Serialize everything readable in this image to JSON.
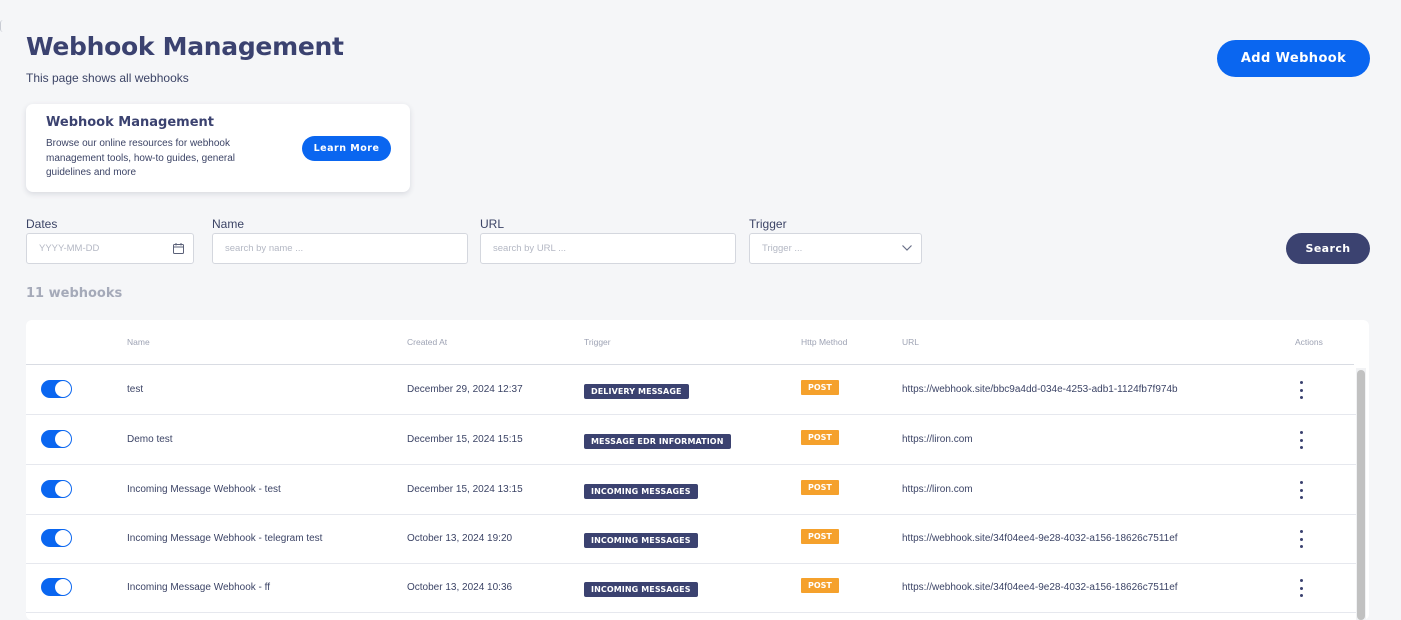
{
  "header": {
    "title": "Webhook Management",
    "subtitle": "This page shows all webhooks",
    "add_button": "Add Webhook"
  },
  "info_card": {
    "title": "Webhook Management",
    "description": "Browse our online resources for webhook management tools, how-to guides, general guidelines and more",
    "button": "Learn More"
  },
  "filters": {
    "dates": {
      "label": "Dates",
      "placeholder": "YYYY-MM-DD"
    },
    "name": {
      "label": "Name",
      "placeholder": "search by name ..."
    },
    "url": {
      "label": "URL",
      "placeholder": "search by URL ..."
    },
    "trigger": {
      "label": "Trigger",
      "placeholder": "Trigger ..."
    },
    "search_button": "Search"
  },
  "count_label": "11 webhooks",
  "table": {
    "columns": [
      "Name",
      "Created At",
      "Trigger",
      "Http Method",
      "URL",
      "Actions"
    ],
    "rows": [
      {
        "enabled": true,
        "name": "test",
        "created_at": "December 29, 2024 12:37",
        "trigger": "DELIVERY MESSAGE",
        "method": "POST",
        "url": "https://webhook.site/bbc9a4dd-034e-4253-adb1-1124fb7f974b"
      },
      {
        "enabled": true,
        "name": "Demo test",
        "created_at": "December 15, 2024 15:15",
        "trigger": "MESSAGE EDR INFORMATION",
        "method": "POST",
        "url": "https://liron.com"
      },
      {
        "enabled": true,
        "name": "Incoming Message Webhook - test",
        "created_at": "December 15, 2024 13:15",
        "trigger": "INCOMING MESSAGES",
        "method": "POST",
        "url": "https://liron.com"
      },
      {
        "enabled": true,
        "name": "Incoming Message Webhook - telegram test",
        "created_at": "October 13, 2024 19:20",
        "trigger": "INCOMING MESSAGES",
        "method": "POST",
        "url": "https://webhook.site/34f04ee4-9e28-4032-a156-18626c7511ef"
      },
      {
        "enabled": true,
        "name": "Incoming Message Webhook - ff",
        "created_at": "October 13, 2024 10:36",
        "trigger": "INCOMING MESSAGES",
        "method": "POST",
        "url": "https://webhook.site/34f04ee4-9e28-4032-a156-18626c7511ef"
      }
    ]
  },
  "colors": {
    "primary": "#0a66f0",
    "navy": "#3b4270",
    "post_badge": "#f5a12c"
  },
  "icons": {
    "date": "calendar-icon",
    "trigger_dropdown": "chevron-down-icon",
    "row_actions": "kebab-menu-icon"
  }
}
